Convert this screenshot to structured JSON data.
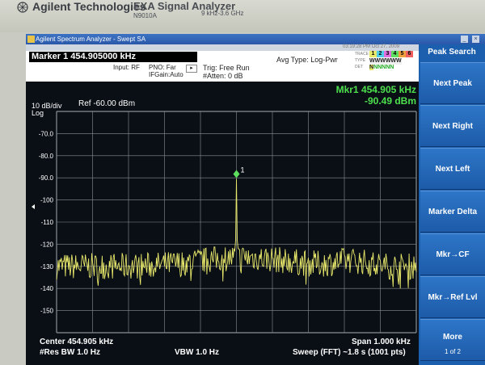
{
  "bezel": {
    "brand": "Agilent Technologies",
    "model": "EXA Signal Analyzer",
    "model_number": "N9010A",
    "freq_range": "9 kHz-3.6 GHz"
  },
  "window": {
    "title": "Agilent Spectrum Analyzer - Swept SA"
  },
  "header": {
    "marker_label": "Marker 1  454.905000 kHz",
    "input": "Input: RF",
    "pno": "PNO: Far",
    "if_gain": "IFGain:Auto",
    "trig": "Trig: Free Run",
    "atten": "#Atten: 0 dB",
    "avg_type": "Avg Type: Log-Pwr",
    "timestamp": "03:19:28 PM Oct 27, 2009",
    "trace_label": "TRACE",
    "type_label": "TYPE",
    "det_label": "DET",
    "trace_numbers": [
      "1",
      "2",
      "3",
      "4",
      "5",
      "6"
    ],
    "type_row": "WWWWWW",
    "det_row": "NNNNNN"
  },
  "readout": {
    "marker_freq": "Mkr1 454.905 kHz",
    "marker_level": "-90.49 dBm"
  },
  "scale": {
    "per_div": "10 dB/div",
    "log": "Log",
    "ref": "Ref -60.00 dBm",
    "y_labels": [
      "-70.0",
      "-80.0",
      "-90.0",
      "-100",
      "-110",
      "-120",
      "-130",
      "-140",
      "-150"
    ]
  },
  "footer": {
    "center": "Center 454.905 kHz",
    "res_bw": "#Res BW 1.0 Hz",
    "vbw": "VBW 1.0 Hz",
    "span": "Span 1.000 kHz",
    "sweep": "Sweep (FFT)  ~1.8 s (1001 pts)"
  },
  "marker": {
    "label": "1",
    "level_dbm": -90.49
  },
  "softkeys": {
    "title": "Peak Search",
    "items": [
      {
        "label": "Next Peak"
      },
      {
        "label": "Next Right"
      },
      {
        "label": "Next Left"
      },
      {
        "label": "Marker Delta"
      },
      {
        "label": "Mkr→CF"
      },
      {
        "label": "Mkr→Ref Lvl"
      },
      {
        "label": "More",
        "sub": "1 of 2"
      }
    ]
  },
  "colors": {
    "trace": "#e8e86a",
    "readout": "#4de04d",
    "softkey": "#1c5fae",
    "grid": "#8a8f96"
  }
}
